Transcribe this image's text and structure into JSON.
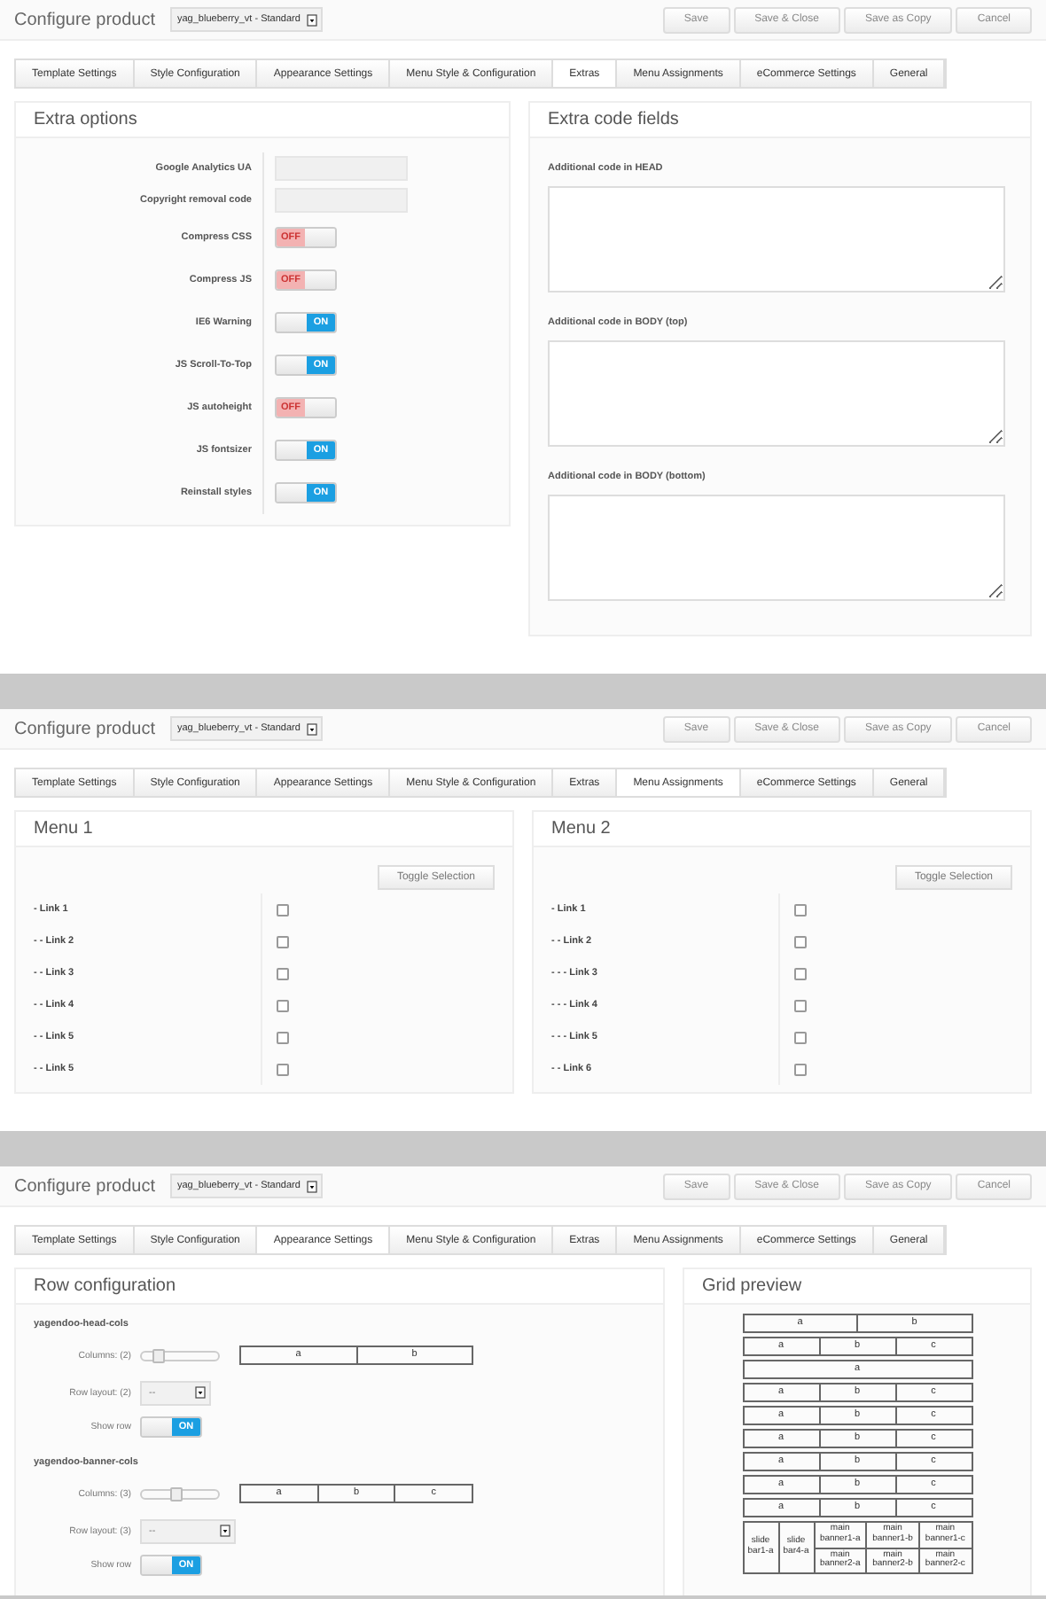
{
  "screens": [
    {
      "kind": "extras",
      "title": "Configure product",
      "template": "yag_blueberry_vt - Standard",
      "buttons": [
        "Save",
        "Save & Close",
        "Save as Copy",
        "Cancel"
      ],
      "tabs": [
        {
          "label": "Template Settings",
          "selected": false
        },
        {
          "label": "Style Configuration",
          "selected": false
        },
        {
          "label": "Appearance Settings",
          "selected": false
        },
        {
          "label": "Menu Style & Configuration",
          "selected": false
        },
        {
          "label": "Extras",
          "selected": true
        },
        {
          "label": "Menu Assignments",
          "selected": false
        },
        {
          "label": "eCommerce Settings",
          "selected": false
        },
        {
          "label": "General",
          "selected": false
        }
      ],
      "options_panel": {
        "title": "Extra options",
        "options": [
          {
            "kind": "text",
            "label": "Google Analytics UA"
          },
          {
            "kind": "text",
            "label": "Copyright removal code"
          },
          {
            "kind": "toggle",
            "label": "Compress CSS",
            "on": false,
            "state": "OFF"
          },
          {
            "kind": "toggle",
            "label": "Compress JS",
            "on": false,
            "state": "OFF"
          },
          {
            "kind": "toggle",
            "label": "IE6 Warning",
            "on": true,
            "state": "ON"
          },
          {
            "kind": "toggle",
            "label": "JS Scroll-To-Top",
            "on": true,
            "state": "ON"
          },
          {
            "kind": "toggle",
            "label": "JS autoheight",
            "on": false,
            "state": "OFF"
          },
          {
            "kind": "toggle",
            "label": "JS fontsizer",
            "on": true,
            "state": "ON"
          },
          {
            "kind": "toggle",
            "label": "Reinstall styles",
            "on": true,
            "state": "ON"
          }
        ]
      },
      "code_panel": {
        "title": "Extra code fields",
        "fields": [
          {
            "label": "Additional code in HEAD"
          },
          {
            "label": "Additional code in BODY (top)"
          },
          {
            "label": "Additional code in BODY (bottom)"
          }
        ]
      }
    },
    {
      "kind": "menus",
      "title": "Configure product",
      "template": "yag_blueberry_vt - Standard",
      "buttons": [
        "Save",
        "Save & Close",
        "Save as Copy",
        "Cancel"
      ],
      "tabs": [
        {
          "label": "Template Settings",
          "selected": false
        },
        {
          "label": "Style Configuration",
          "selected": false
        },
        {
          "label": "Appearance Settings",
          "selected": false
        },
        {
          "label": "Menu Style & Configuration",
          "selected": false
        },
        {
          "label": "Extras",
          "selected": false
        },
        {
          "label": "Menu Assignments",
          "selected": true
        },
        {
          "label": "eCommerce Settings",
          "selected": false
        },
        {
          "label": "General",
          "selected": false
        }
      ],
      "menus": [
        {
          "title": "Menu 1",
          "button": "Toggle Selection",
          "links": [
            {
              "label": "- Link 1",
              "checked": false
            },
            {
              "label": "- - Link 2",
              "checked": false
            },
            {
              "label": "- - Link 3",
              "checked": false
            },
            {
              "label": "- - Link 4",
              "checked": false
            },
            {
              "label": "- - Link 5",
              "checked": false
            },
            {
              "label": "- - Link 5",
              "checked": false
            }
          ]
        },
        {
          "title": "Menu 2",
          "button": "Toggle Selection",
          "links": [
            {
              "label": "- Link 1",
              "checked": false
            },
            {
              "label": "- - Link 2",
              "checked": false
            },
            {
              "label": "- - - Link 3",
              "checked": false
            },
            {
              "label": "- - - Link 4",
              "checked": false
            },
            {
              "label": "- - - Link 5",
              "checked": false
            },
            {
              "label": "- - Link 6",
              "checked": false
            }
          ]
        }
      ]
    },
    {
      "kind": "rows",
      "title": "Configure product",
      "template": "yag_blueberry_vt - Standard",
      "buttons": [
        "Save",
        "Save & Close",
        "Save as Copy",
        "Cancel"
      ],
      "tabs": [
        {
          "label": "Template Settings",
          "selected": false
        },
        {
          "label": "Style Configuration",
          "selected": false
        },
        {
          "label": "Appearance Settings",
          "selected": true
        },
        {
          "label": "Menu Style & Configuration",
          "selected": false
        },
        {
          "label": "Extras",
          "selected": false
        },
        {
          "label": "Menu Assignments",
          "selected": false
        },
        {
          "label": "eCommerce Settings",
          "selected": false
        },
        {
          "label": "General",
          "selected": false
        }
      ],
      "rows_panel": {
        "title": "Row configuration",
        "rows": [
          {
            "name": "yagendoo-head-cols",
            "columns_label": "Columns: (2)",
            "level": 0.2,
            "cells": [
              "a",
              "b"
            ],
            "layout_label": "Row layout: (2)",
            "layout_value": "--",
            "show_label": "Show row",
            "on": true,
            "state": "ON"
          },
          {
            "name": "yagendoo-banner-cols",
            "columns_label": "Columns: (3)",
            "level": 0.45,
            "cells": [
              "a",
              "b",
              "c"
            ],
            "layout_label": "Row layout: (3)",
            "layout_value": "--",
            "show_label": "Show row",
            "on": true,
            "state": "ON"
          }
        ]
      },
      "grid_panel": {
        "title": "Grid preview",
        "rows": [
          {
            "kind": "simple",
            "cells": [
              "a",
              "b"
            ]
          },
          {
            "kind": "simple",
            "cells": [
              "a",
              "b",
              "c"
            ]
          },
          {
            "kind": "simple",
            "cells": [
              "a"
            ]
          },
          {
            "kind": "simple",
            "cells": [
              "a",
              "b",
              "c"
            ]
          },
          {
            "kind": "simple",
            "cells": [
              "a",
              "b",
              "c"
            ]
          },
          {
            "kind": "simple",
            "cells": [
              "a",
              "b",
              "c"
            ]
          },
          {
            "kind": "simple",
            "cells": [
              "a",
              "b",
              "c"
            ]
          },
          {
            "kind": "simple",
            "cells": [
              "a",
              "b",
              "c"
            ]
          },
          {
            "kind": "simple",
            "cells": [
              "a",
              "b",
              "c"
            ]
          },
          {
            "kind": "complex",
            "side": [
              "slide bar1-a",
              "slide bar4-a"
            ],
            "main": [
              [
                "main banner1-a",
                "main banner1-b",
                "main banner1-c"
              ],
              [
                "main banner2-a",
                "main banner2-b",
                "main banner2-c"
              ]
            ]
          }
        ]
      }
    }
  ]
}
